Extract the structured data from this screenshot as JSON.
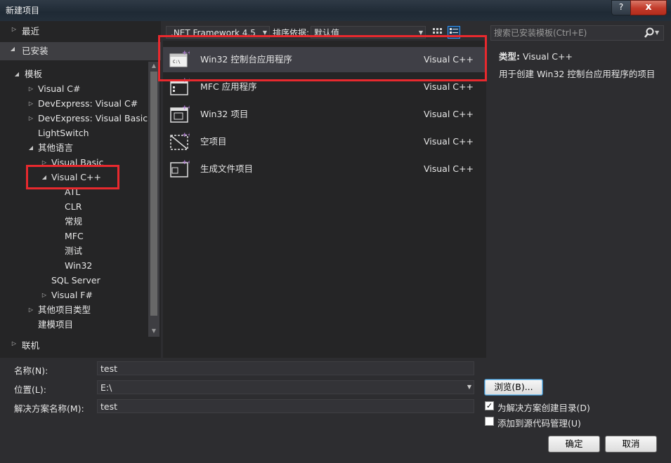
{
  "window": {
    "title": "新建项目",
    "help_glyph": "?",
    "close_glyph": "x"
  },
  "left_tree": {
    "recent": "最近",
    "installed": "已安装",
    "templates": "模板",
    "items": [
      {
        "label": "Visual C#",
        "expander": "collapsed"
      },
      {
        "label": "DevExpress: Visual C#",
        "expander": "collapsed"
      },
      {
        "label": "DevExpress: Visual Basic",
        "expander": "collapsed"
      },
      {
        "label": "LightSwitch",
        "expander": "none"
      },
      {
        "label": "其他语言",
        "expander": "expanded"
      },
      {
        "label": "Visual Basic",
        "expander": "collapsed"
      },
      {
        "label": "Visual C++",
        "expander": "expanded"
      },
      {
        "label": "ATL",
        "expander": "none"
      },
      {
        "label": "CLR",
        "expander": "none"
      },
      {
        "label": "常规",
        "expander": "none"
      },
      {
        "label": "MFC",
        "expander": "none"
      },
      {
        "label": "测试",
        "expander": "none"
      },
      {
        "label": "Win32",
        "expander": "none"
      },
      {
        "label": "SQL Server",
        "expander": "none"
      },
      {
        "label": "Visual F#",
        "expander": "collapsed"
      },
      {
        "label": "其他项目类型",
        "expander": "collapsed"
      },
      {
        "label": "建模项目",
        "expander": "none"
      }
    ],
    "online": "联机"
  },
  "toolbar": {
    "framework": ".NET Framework 4.5",
    "sort_label": "排序依据:",
    "sort_value": "默认值"
  },
  "templates": [
    {
      "name": "Win32 控制台应用程序",
      "language": "Visual C++",
      "icon": "console-app-icon"
    },
    {
      "name": "MFC 应用程序",
      "language": "Visual C++",
      "icon": "mfc-app-icon"
    },
    {
      "name": "Win32 项目",
      "language": "Visual C++",
      "icon": "win32-project-icon"
    },
    {
      "name": "空项目",
      "language": "Visual C++",
      "icon": "empty-project-icon"
    },
    {
      "name": "生成文件项目",
      "language": "Visual C++",
      "icon": "makefile-project-icon"
    }
  ],
  "search": {
    "placeholder": "搜索已安装模板(Ctrl+E)"
  },
  "description": {
    "type_label": "类型:",
    "type_value": "Visual C++",
    "text": "用于创建 Win32 控制台应用程序的项目"
  },
  "form": {
    "name_label": "名称(N):",
    "name_value": "test",
    "location_label": "位置(L):",
    "location_value": "E:\\",
    "solution_label": "解决方案名称(M):",
    "solution_value": "test",
    "browse_button": "浏览(B)...",
    "create_dir_label": "为解决方案创建目录(D)",
    "create_dir_checked": true,
    "source_control_label": "添加到源代码管理(U)",
    "source_control_checked": false,
    "ok_button": "确定",
    "cancel_button": "取消"
  },
  "colors": {
    "highlight_red": "#e8292e",
    "background": "#2d2d30",
    "panel": "#252526",
    "selected_row": "#3f3f46"
  }
}
